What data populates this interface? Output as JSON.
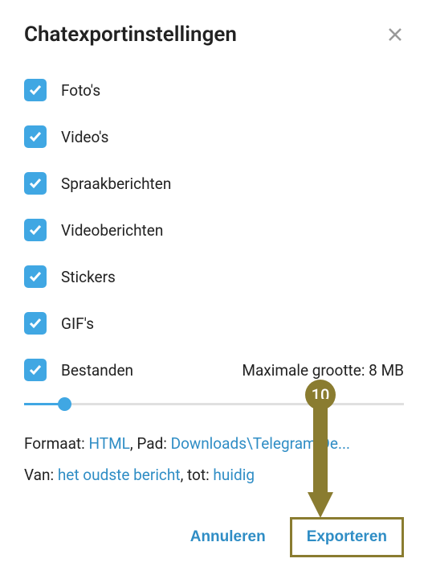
{
  "dialog": {
    "title": "Chatexportinstellingen"
  },
  "options": [
    {
      "label": "Foto's"
    },
    {
      "label": "Video's"
    },
    {
      "label": "Spraakberichten"
    },
    {
      "label": "Videoberichten"
    },
    {
      "label": "Stickers"
    },
    {
      "label": "GIF's"
    }
  ],
  "files": {
    "label": "Bestanden",
    "max_prefix": "Maximale grootte: ",
    "max_value": "8 MB"
  },
  "info": {
    "format_label": "Formaat: ",
    "format_value": "HTML",
    "path_label": ", Pad: ",
    "path_value": "Downloads\\Telegram De...",
    "from_label": "Van: ",
    "from_value": "het oudste bericht",
    "to_label": ", tot: ",
    "to_value": "huidig"
  },
  "footer": {
    "cancel": "Annuleren",
    "export": "Exporteren"
  },
  "annotation": {
    "number": "10"
  }
}
